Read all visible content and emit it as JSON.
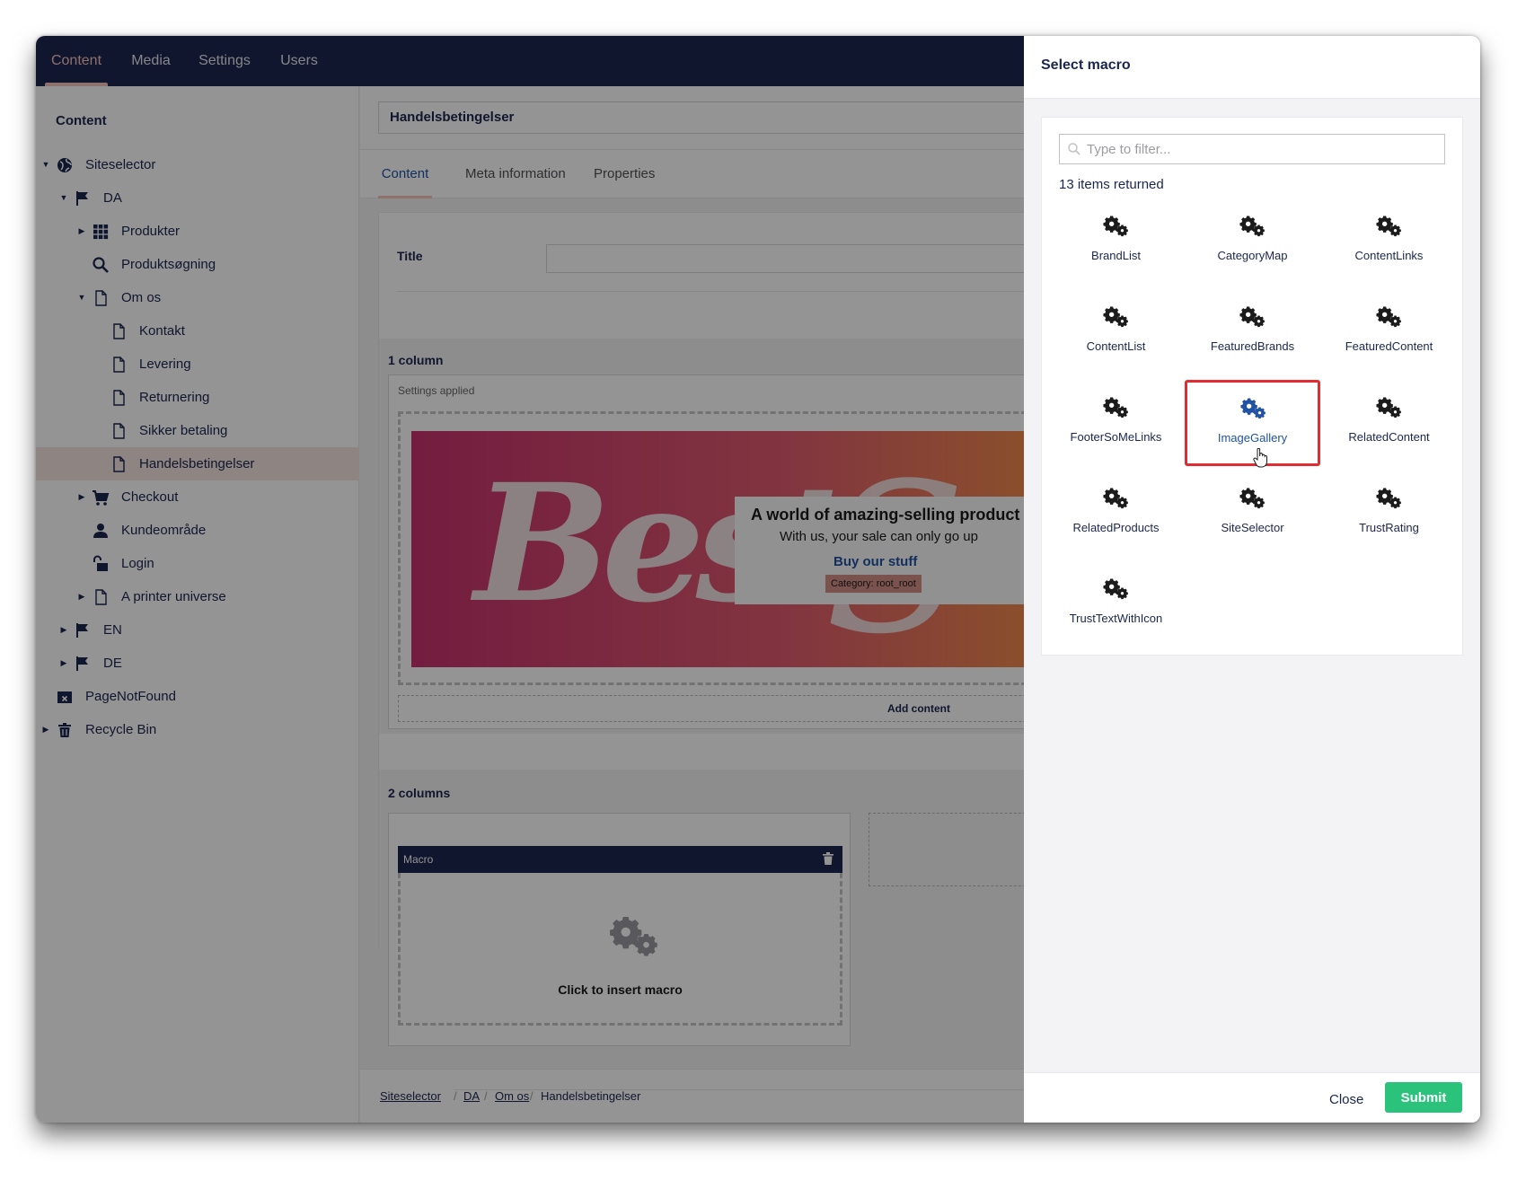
{
  "topnav": {
    "tabs": [
      {
        "label": "Content",
        "active": true
      },
      {
        "label": "Media"
      },
      {
        "label": "Settings"
      },
      {
        "label": "Users"
      }
    ]
  },
  "sidebar": {
    "title": "Content",
    "tree": [
      {
        "label": "Siteselector",
        "icon": "globe-icon",
        "caret": "down"
      },
      {
        "label": "DA",
        "icon": "flag-icon",
        "caret": "down"
      },
      {
        "label": "Produkter",
        "icon": "grid-icon",
        "caret": "right"
      },
      {
        "label": "Produktsøgning",
        "icon": "search-icon"
      },
      {
        "label": "Om os",
        "icon": "document-icon",
        "caret": "down"
      },
      {
        "label": "Kontakt",
        "icon": "document-icon"
      },
      {
        "label": "Levering",
        "icon": "document-icon"
      },
      {
        "label": "Returnering",
        "icon": "document-icon"
      },
      {
        "label": "Sikker betaling",
        "icon": "document-icon"
      },
      {
        "label": "Handelsbetingelser",
        "icon": "document-icon",
        "selected": true
      },
      {
        "label": "Checkout",
        "icon": "cart-icon",
        "caret": "right"
      },
      {
        "label": "Kundeområde",
        "icon": "user-icon"
      },
      {
        "label": "Login",
        "icon": "unlock-icon"
      },
      {
        "label": "A printer universe",
        "icon": "document-icon",
        "caret": "right"
      },
      {
        "label": "EN",
        "icon": "flag-icon",
        "caret": "right"
      },
      {
        "label": "DE",
        "icon": "flag-icon",
        "caret": "right"
      },
      {
        "label": "PageNotFound",
        "icon": "window-close-icon"
      },
      {
        "label": "Recycle Bin",
        "icon": "trash-icon",
        "caret": "right"
      }
    ]
  },
  "editor": {
    "name_value": "Handelsbetingelser",
    "tabs": [
      "Content",
      "Meta information",
      "Properties"
    ],
    "title_label": "Title",
    "one_column": {
      "title": "1 column",
      "settings_applied": "Settings applied",
      "banner_art": "Best",
      "banner_art2": "S",
      "promo_title": "A world of amazing-selling product",
      "promo_sub": "With us, your sale can only go up",
      "promo_link": "Buy our stuff",
      "promo_category": "Category: root_root",
      "add_content": "Add content"
    },
    "two_columns": {
      "title": "2 columns",
      "macro_header": "Macro",
      "macro_cta": "Click to insert macro"
    },
    "breadcrumb": [
      "Siteselector",
      "DA",
      "Om os",
      "Handelsbetingelser"
    ]
  },
  "dialog": {
    "title": "Select macro",
    "filter_placeholder": "Type to filter...",
    "count": "13 items returned",
    "items": [
      "BrandList",
      "CategoryMap",
      "ContentLinks",
      "ContentList",
      "FeaturedBrands",
      "FeaturedContent",
      "FooterSoMeLinks",
      "ImageGallery",
      "RelatedContent",
      "RelatedProducts",
      "SiteSelector",
      "TrustRating",
      "TrustTextWithIcon"
    ],
    "hovered_item": "ImageGallery",
    "close_label": "Close",
    "submit_label": "Submit"
  },
  "colors": {
    "nav": "#1b264f",
    "accent": "#f5c1bc",
    "link": "#2152a3",
    "submit": "#2bc37c",
    "highlight": "#e22c32"
  }
}
